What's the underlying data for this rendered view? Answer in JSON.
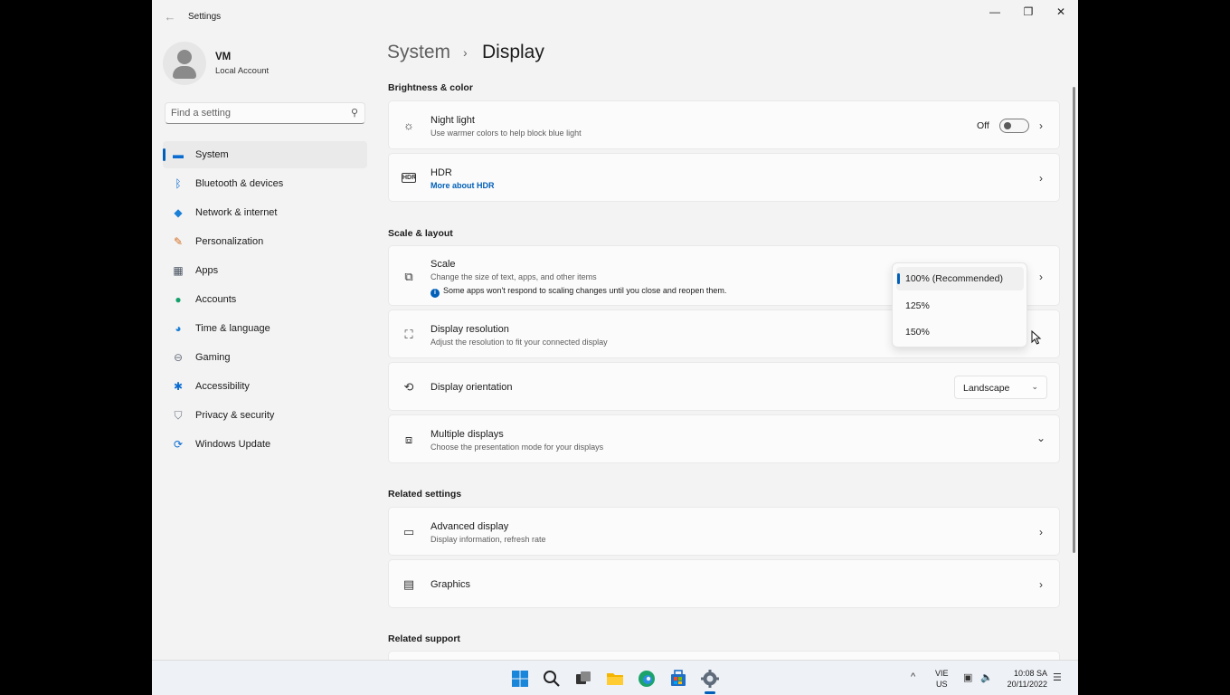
{
  "window": {
    "title": "Settings",
    "back_glyph": "←",
    "minimize_glyph": "—",
    "maximize_glyph": "❐",
    "close_glyph": "✕"
  },
  "profile": {
    "name": "VM",
    "account_type": "Local Account"
  },
  "search": {
    "placeholder": "Find a setting",
    "icon_glyph": "⚲"
  },
  "nav": {
    "items": [
      {
        "label": "System",
        "icon": "system-icon",
        "glyph": "▬",
        "color": "#0a6cd1",
        "active": true
      },
      {
        "label": "Bluetooth & devices",
        "icon": "bluetooth-icon",
        "glyph": "ᛒ",
        "color": "#0a6cd1"
      },
      {
        "label": "Network & internet",
        "icon": "wifi-icon",
        "glyph": "◆",
        "color": "#1a7fd6"
      },
      {
        "label": "Personalization",
        "icon": "brush-icon",
        "glyph": "✎",
        "color": "#d46a1d"
      },
      {
        "label": "Apps",
        "icon": "apps-icon",
        "glyph": "▦",
        "color": "#4b5563"
      },
      {
        "label": "Accounts",
        "icon": "accounts-icon",
        "glyph": "●",
        "color": "#13a06a"
      },
      {
        "label": "Time & language",
        "icon": "globe-icon",
        "glyph": "◕",
        "color": "#1a7fd6"
      },
      {
        "label": "Gaming",
        "icon": "gamepad-icon",
        "glyph": "⊖",
        "color": "#6b7280"
      },
      {
        "label": "Accessibility",
        "icon": "accessibility-icon",
        "glyph": "✱",
        "color": "#0a6cd1"
      },
      {
        "label": "Privacy & security",
        "icon": "shield-icon",
        "glyph": "⛉",
        "color": "#6b7280"
      },
      {
        "label": "Windows Update",
        "icon": "update-icon",
        "glyph": "⟳",
        "color": "#0a6cd1"
      }
    ]
  },
  "breadcrumb": {
    "parent": "System",
    "separator": "›",
    "current": "Display"
  },
  "sections": {
    "brightness": "Brightness & color",
    "scale_layout": "Scale & layout",
    "related_settings": "Related settings",
    "related_support": "Related support"
  },
  "night_light": {
    "title": "Night light",
    "description": "Use warmer colors to help block blue light",
    "state": "Off",
    "icon_glyph": "☼"
  },
  "hdr": {
    "title": "HDR",
    "link": "More about HDR",
    "icon_glyph": "HDR"
  },
  "scale": {
    "title": "Scale",
    "description": "Change the size of text, apps, and other items",
    "info": "Some apps won't respond to scaling changes until you close and reopen them.",
    "info_glyph": "i",
    "icon_glyph": "⧉",
    "options": [
      "100% (Recommended)",
      "125%",
      "150%"
    ],
    "selected": "100% (Recommended)"
  },
  "resolution": {
    "title": "Display resolution",
    "description": "Adjust the resolution to fit your connected display",
    "icon_glyph": "⛶"
  },
  "orientation": {
    "title": "Display orientation",
    "value": "Landscape",
    "icon_glyph": "⟲",
    "chevron_glyph": "⌄"
  },
  "multiple_displays": {
    "title": "Multiple displays",
    "description": "Choose the presentation mode for your displays",
    "icon_glyph": "⧈",
    "chevron_glyph": "⌄"
  },
  "advanced_display": {
    "title": "Advanced display",
    "description": "Display information, refresh rate",
    "icon_glyph": "▭"
  },
  "graphics": {
    "title": "Graphics",
    "icon_glyph": "▤"
  },
  "chevron_glyph": "›",
  "taskbar": {
    "input_language": "VIE",
    "input_region": "US",
    "time": "10:08 SA",
    "date": "20/11/2022",
    "tray_up_glyph": "^",
    "network_glyph": "▣",
    "volume_glyph": "🔈",
    "notification_glyph": "☰"
  },
  "colors": {
    "accent": "#005fb8",
    "background": "#f3f3f3",
    "card": "#fbfbfb"
  }
}
